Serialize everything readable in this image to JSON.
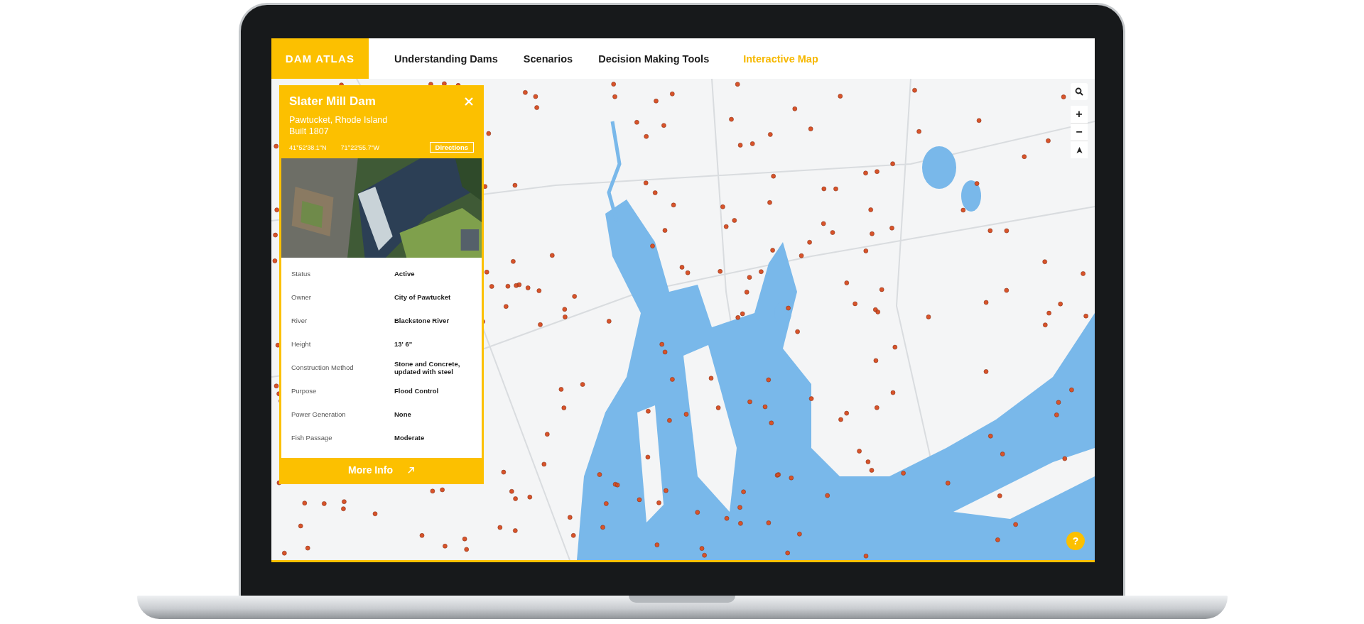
{
  "brand": "DAM ATLAS",
  "nav": [
    {
      "label": "Understanding Dams",
      "selected": false
    },
    {
      "label": "Scenarios",
      "selected": false
    },
    {
      "label": "Decision Making Tools",
      "selected": false
    },
    {
      "label": "Interactive Map",
      "selected": true
    }
  ],
  "dam_panel": {
    "title": "Slater Mill Dam",
    "location": "Pawtucket, Rhode Island",
    "built": "Built 1807",
    "latitude": "41°52'38.1\"N",
    "longitude": "71°22'55.7\"W",
    "directions_button": "Directions",
    "details": [
      {
        "label": "Status",
        "value": "Active"
      },
      {
        "label": "Owner",
        "value": "City of Pawtucket"
      },
      {
        "label": "River",
        "value": "Blackstone River"
      },
      {
        "label": "Height",
        "value": "13' 6\""
      },
      {
        "label": "Construction Method",
        "value": "Stone and Concrete, updated with steel"
      },
      {
        "label": "Purpose",
        "value": "Flood Control"
      },
      {
        "label": "Power Generation",
        "value": "None"
      },
      {
        "label": "Fish Passage",
        "value": "Moderate"
      }
    ],
    "more_info_button": "More Info"
  },
  "map_controls": {
    "zoom_in": "+",
    "zoom_out": "−"
  },
  "help_button": "?"
}
